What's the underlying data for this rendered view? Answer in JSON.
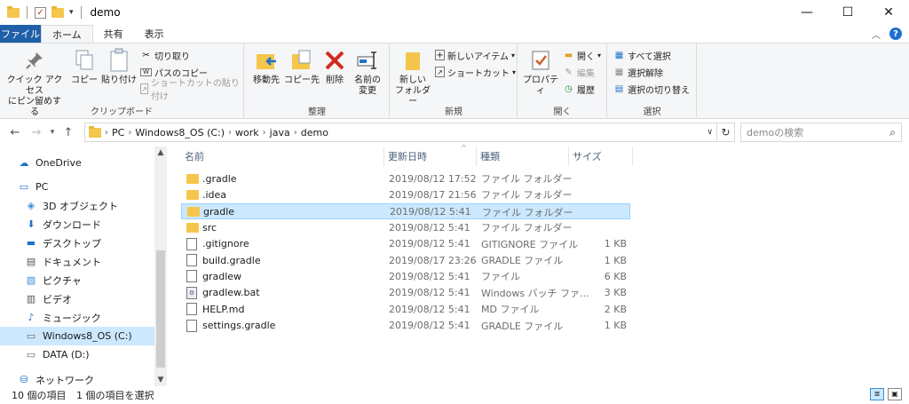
{
  "window": {
    "title": "demo",
    "controls": {
      "minimize": "—",
      "maximize": "☐",
      "close": "✕"
    }
  },
  "tabs": [
    {
      "label": "ファイル",
      "state": "file"
    },
    {
      "label": "ホーム",
      "state": "active"
    },
    {
      "label": "共有",
      "state": "normal"
    },
    {
      "label": "表示",
      "state": "normal"
    }
  ],
  "ribbon": {
    "clipboard": {
      "label": "クリップボード",
      "pin_line1": "クイック アクセス",
      "pin_line2": "にピン留めする",
      "copy": "コピー",
      "paste": "貼り付け",
      "cut": "切り取り",
      "copy_path": "パスのコピー",
      "paste_shortcut": "ショートカットの貼り付け"
    },
    "organize": {
      "label": "整理",
      "move_line1": "移動先",
      "copy_line1": "コピー先",
      "delete": "削除",
      "rename_line1": "名前の",
      "rename_line2": "変更"
    },
    "new": {
      "label": "新規",
      "new_folder_line1": "新しい",
      "new_folder_line2": "フォルダー",
      "new_item": "新しいアイテム",
      "shortcut": "ショートカット"
    },
    "open": {
      "label": "開く",
      "properties": "プロパティ",
      "open": "開く",
      "edit": "編集",
      "history": "履歴"
    },
    "select": {
      "label": "選択",
      "select_all": "すべて選択",
      "select_none": "選択解除",
      "invert": "選択の切り替え"
    }
  },
  "address": {
    "crumbs": [
      "PC",
      "Windows8_OS (C:)",
      "work",
      "java",
      "demo"
    ],
    "search_placeholder": "demoの検索"
  },
  "nav": {
    "items": [
      {
        "label": "OneDrive",
        "icon": "cloud-icon",
        "indent": 0,
        "selected": false
      },
      {
        "label": "PC",
        "icon": "computer-icon",
        "indent": 0,
        "selected": false
      },
      {
        "label": "3D オブジェクト",
        "icon": "cube-icon",
        "indent": 1,
        "selected": false
      },
      {
        "label": "ダウンロード",
        "icon": "download-icon",
        "indent": 1,
        "selected": false
      },
      {
        "label": "デスクトップ",
        "icon": "desktop-icon",
        "indent": 1,
        "selected": false
      },
      {
        "label": "ドキュメント",
        "icon": "document-icon",
        "indent": 1,
        "selected": false
      },
      {
        "label": "ピクチャ",
        "icon": "picture-icon",
        "indent": 1,
        "selected": false
      },
      {
        "label": "ビデオ",
        "icon": "video-icon",
        "indent": 1,
        "selected": false
      },
      {
        "label": "ミュージック",
        "icon": "music-icon",
        "indent": 1,
        "selected": false
      },
      {
        "label": "Windows8_OS (C:)",
        "icon": "drive-icon",
        "indent": 1,
        "selected": true
      },
      {
        "label": "DATA (D:)",
        "icon": "drive-icon",
        "indent": 1,
        "selected": false
      },
      {
        "label": "ネットワーク",
        "icon": "network-icon",
        "indent": 0,
        "selected": false
      }
    ]
  },
  "columns": {
    "name": "名前",
    "date": "更新日時",
    "type": "種類",
    "size": "サイズ"
  },
  "files": [
    {
      "name": ".gradle",
      "date": "2019/08/12 17:52",
      "type": "ファイル フォルダー",
      "size": "",
      "kind": "folder",
      "selected": false
    },
    {
      "name": ".idea",
      "date": "2019/08/17 21:56",
      "type": "ファイル フォルダー",
      "size": "",
      "kind": "folder",
      "selected": false
    },
    {
      "name": "gradle",
      "date": "2019/08/12 5:41",
      "type": "ファイル フォルダー",
      "size": "",
      "kind": "folder",
      "selected": true
    },
    {
      "name": "src",
      "date": "2019/08/12 5:41",
      "type": "ファイル フォルダー",
      "size": "",
      "kind": "folder",
      "selected": false
    },
    {
      "name": ".gitignore",
      "date": "2019/08/12 5:41",
      "type": "GITIGNORE ファイル",
      "size": "1 KB",
      "kind": "file",
      "selected": false
    },
    {
      "name": "build.gradle",
      "date": "2019/08/17 23:26",
      "type": "GRADLE ファイル",
      "size": "1 KB",
      "kind": "file",
      "selected": false
    },
    {
      "name": "gradlew",
      "date": "2019/08/12 5:41",
      "type": "ファイル",
      "size": "6 KB",
      "kind": "file",
      "selected": false
    },
    {
      "name": "gradlew.bat",
      "date": "2019/08/12 5:41",
      "type": "Windows バッチ ファ...",
      "size": "3 KB",
      "kind": "bat",
      "selected": false
    },
    {
      "name": "HELP.md",
      "date": "2019/08/12 5:41",
      "type": "MD ファイル",
      "size": "2 KB",
      "kind": "file",
      "selected": false
    },
    {
      "name": "settings.gradle",
      "date": "2019/08/12 5:41",
      "type": "GRADLE ファイル",
      "size": "1 KB",
      "kind": "file",
      "selected": false
    }
  ],
  "status": {
    "count": "10 個の項目",
    "selection": "1 個の項目を選択"
  }
}
